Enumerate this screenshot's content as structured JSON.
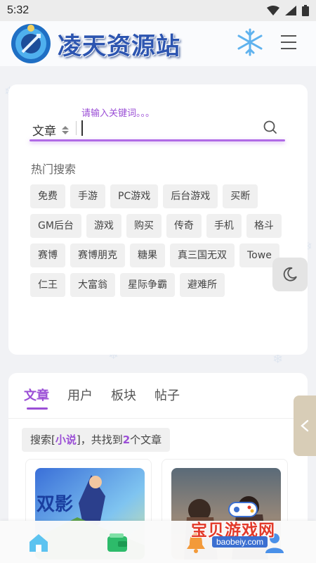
{
  "status_bar": {
    "time": "5:32"
  },
  "header": {
    "logo_text": "凌天资源站"
  },
  "search": {
    "hint": "请输入关键词。。。",
    "type_selected": "文章",
    "value": "",
    "hot_title": "热门搜索",
    "hot_tags": [
      "免费",
      "手游",
      "PC游戏",
      "后台游戏",
      "买断",
      "GM后台",
      "游戏",
      "购买",
      "传奇",
      "手机",
      "格斗",
      "赛博",
      "赛博朋克",
      "糖果",
      "真三国无双",
      "Towe",
      "仁王",
      "大富翁",
      "星际争霸",
      "避难所"
    ]
  },
  "results": {
    "tabs": [
      "文章",
      "用户",
      "板块",
      "帖子"
    ],
    "summary": {
      "prefix": "搜索[",
      "keyword": "小说",
      "middle": "]，共找到",
      "count": "2",
      "suffix": "个文章"
    }
  },
  "watermark": {
    "text": "宝贝游戏网",
    "url": "baobeiy.com"
  },
  "colors": {
    "accent": "#9b4fd6",
    "logo": "#2d55b0",
    "watermark": "#e23a2a"
  }
}
